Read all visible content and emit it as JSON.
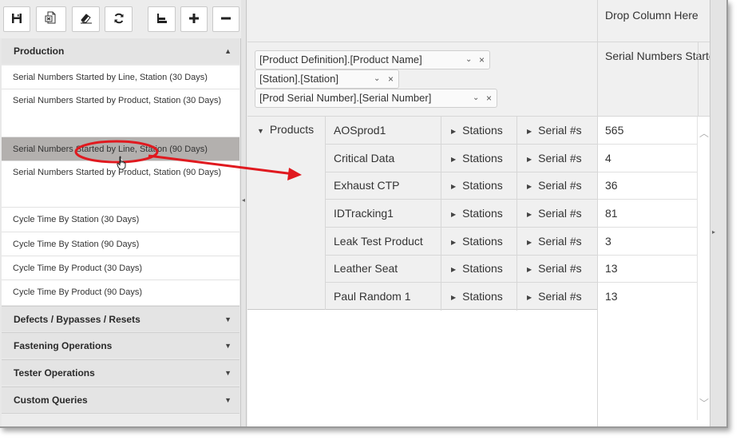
{
  "toolbar": {
    "buttons": [
      {
        "name": "save-button",
        "icon": "save-icon",
        "glyph": "🖫"
      },
      {
        "name": "export-excel-button",
        "icon": "excel-export-icon",
        "glyph": "⎘"
      },
      {
        "name": "clear-button",
        "icon": "eraser-icon",
        "glyph": "⌫"
      },
      {
        "name": "refresh-button",
        "icon": "refresh-icon",
        "glyph": "⟳"
      },
      {
        "name": "layout-button",
        "icon": "layout-icon",
        "glyph": "⊑"
      },
      {
        "name": "add-button",
        "icon": "plus-icon",
        "glyph": "+"
      },
      {
        "name": "remove-button",
        "icon": "minus-icon",
        "glyph": "−"
      }
    ]
  },
  "sidebar": {
    "production": {
      "label": "Production",
      "items": [
        "Serial Numbers Started by Line, Station (30 Days)",
        "Serial Numbers Started by Product, Station (30 Days)",
        "Serial Numbers Started by Line, Station (90 Days)",
        "Serial Numbers Started by Product, Station (90 Days)",
        "Cycle Time By Station (30 Days)",
        "Cycle Time By Station (90 Days)",
        "Cycle Time By Product (30 Days)",
        "Cycle Time By Product (90 Days)"
      ],
      "selected_index": 2
    },
    "sections": [
      "Defects / Bypasses / Resets",
      "Fastening Operations",
      "Tester Operations",
      "Custom Queries"
    ]
  },
  "pivot": {
    "drop_column_label": "Drop Column Here",
    "measure_label": "Serial Numbers Started",
    "row_fields": [
      "[Product Definition].[Product Name]",
      "[Station].[Station]",
      "[Prod Serial Number].[Serial Number]"
    ],
    "products_header": "Products",
    "stations_label": "Stations",
    "serials_label": "Serial #s",
    "rows": [
      {
        "product": "AOSprod1",
        "value": "565"
      },
      {
        "product": "Critical Data",
        "value": "4"
      },
      {
        "product": "Exhaust CTP",
        "value": "36"
      },
      {
        "product": "IDTracking1",
        "value": "81"
      },
      {
        "product": "Leak Test Product",
        "value": "3"
      },
      {
        "product": "Leather Seat",
        "value": "13"
      },
      {
        "product": "Paul Random 1",
        "value": "13"
      }
    ]
  },
  "colors": {
    "selected_row": "#b3b0ae",
    "annotation": "#e0191f",
    "panel_bg": "#e8e8e8"
  }
}
